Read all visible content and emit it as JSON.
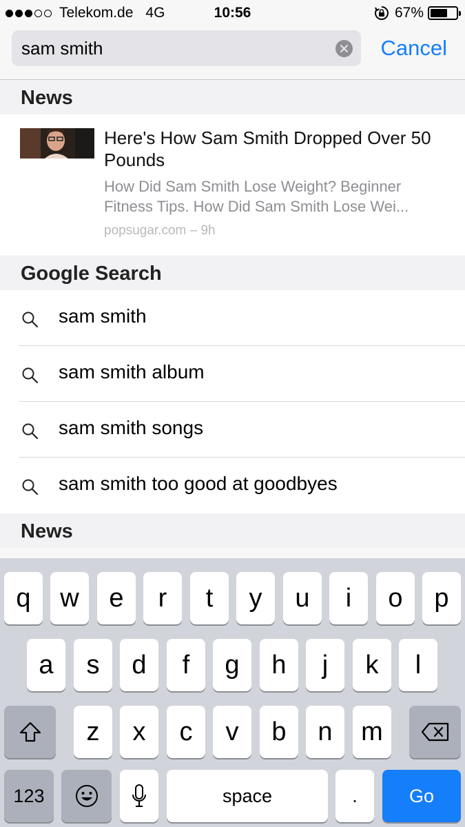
{
  "status_bar": {
    "carrier": "Telekom.de",
    "network": "4G",
    "time": "10:56",
    "battery_text": "67%",
    "battery_level": 0.67,
    "signal_bars_filled": 3,
    "signal_bars_total": 5
  },
  "search": {
    "query": "sam smith",
    "cancel_label": "Cancel"
  },
  "sections": {
    "news_header": "News",
    "google_header": "Google Search",
    "news_header_2": "News"
  },
  "news_item": {
    "title": "Here's How Sam Smith Dropped Over 50 Pounds",
    "snippet": "How Did Sam Smith Lose Weight? Beginner Fitness Tips. How Did Sam Smith Lose Wei...",
    "source": "popsugar.com – 9h"
  },
  "suggestions": [
    {
      "label": "sam smith"
    },
    {
      "label": "sam smith album"
    },
    {
      "label": "sam smith songs"
    },
    {
      "label": "sam smith too good at goodbyes"
    }
  ],
  "keyboard": {
    "row1": [
      "q",
      "w",
      "e",
      "r",
      "t",
      "y",
      "u",
      "i",
      "o",
      "p"
    ],
    "row2": [
      "a",
      "s",
      "d",
      "f",
      "g",
      "h",
      "j",
      "k",
      "l"
    ],
    "row3": [
      "z",
      "x",
      "c",
      "v",
      "b",
      "n",
      "m"
    ],
    "numbers_label": "123",
    "space_label": "space",
    "period_label": ".",
    "go_label": "Go"
  },
  "colors": {
    "accent": "#157efb",
    "keyboard_bg": "#d1d4da",
    "secondary_text": "#8e8e93"
  },
  "icons": [
    "lock-rotation-icon",
    "battery-icon",
    "clear-icon",
    "search-icon",
    "shift-icon",
    "backspace-icon",
    "emoji-icon",
    "microphone-icon"
  ]
}
